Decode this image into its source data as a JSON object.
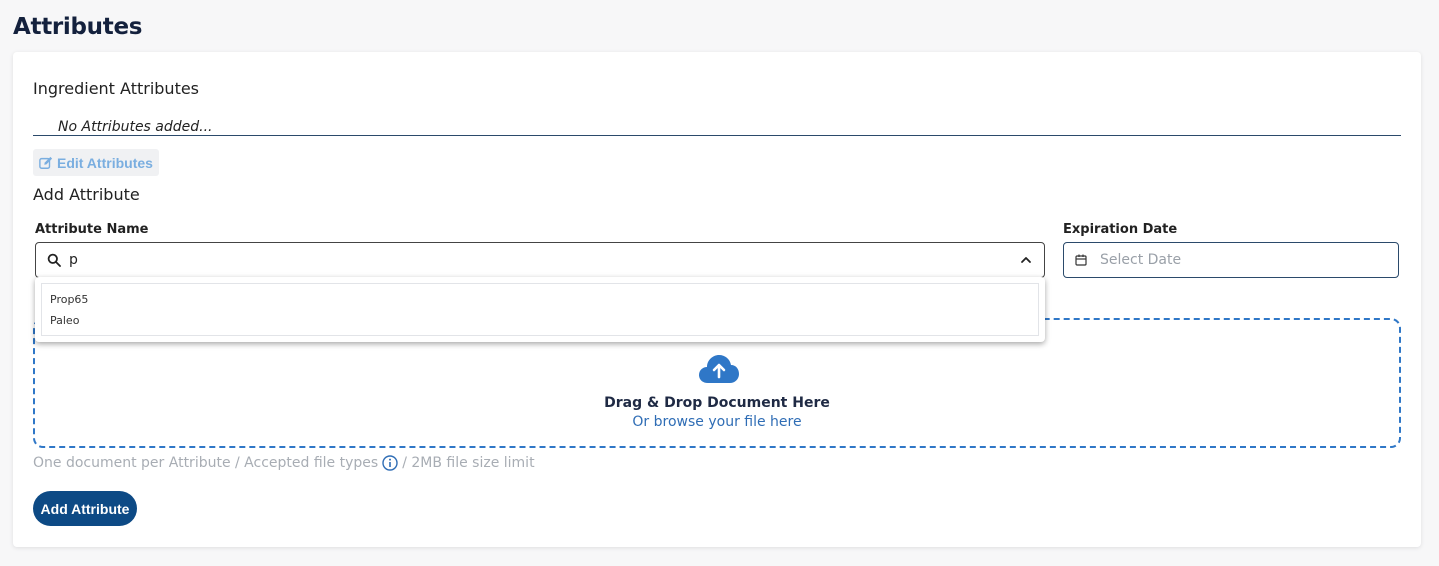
{
  "page": {
    "title": "Attributes"
  },
  "ingredient": {
    "title": "Ingredient Attributes",
    "empty_text": "No Attributes added...",
    "edit_label": "Edit Attributes"
  },
  "add_attribute": {
    "title": "Add Attribute",
    "name_label": "Attribute Name",
    "name_value": "p",
    "date_label": "Expiration Date",
    "date_placeholder": "Select Date",
    "options": [
      "Prop65",
      "Paleo"
    ]
  },
  "upload": {
    "title": "Drag & Drop Document Here",
    "subtitle": "Or browse your file here",
    "hint_before": "One document per Attribute / Accepted file types",
    "hint_after": "/ 2MB file size limit"
  },
  "actions": {
    "add_label": "Add Attribute"
  },
  "colors": {
    "primary": "#0d4a85",
    "link": "#2f6db5",
    "dropzone_border": "#2f77c7",
    "edit": "#7aaee0"
  }
}
